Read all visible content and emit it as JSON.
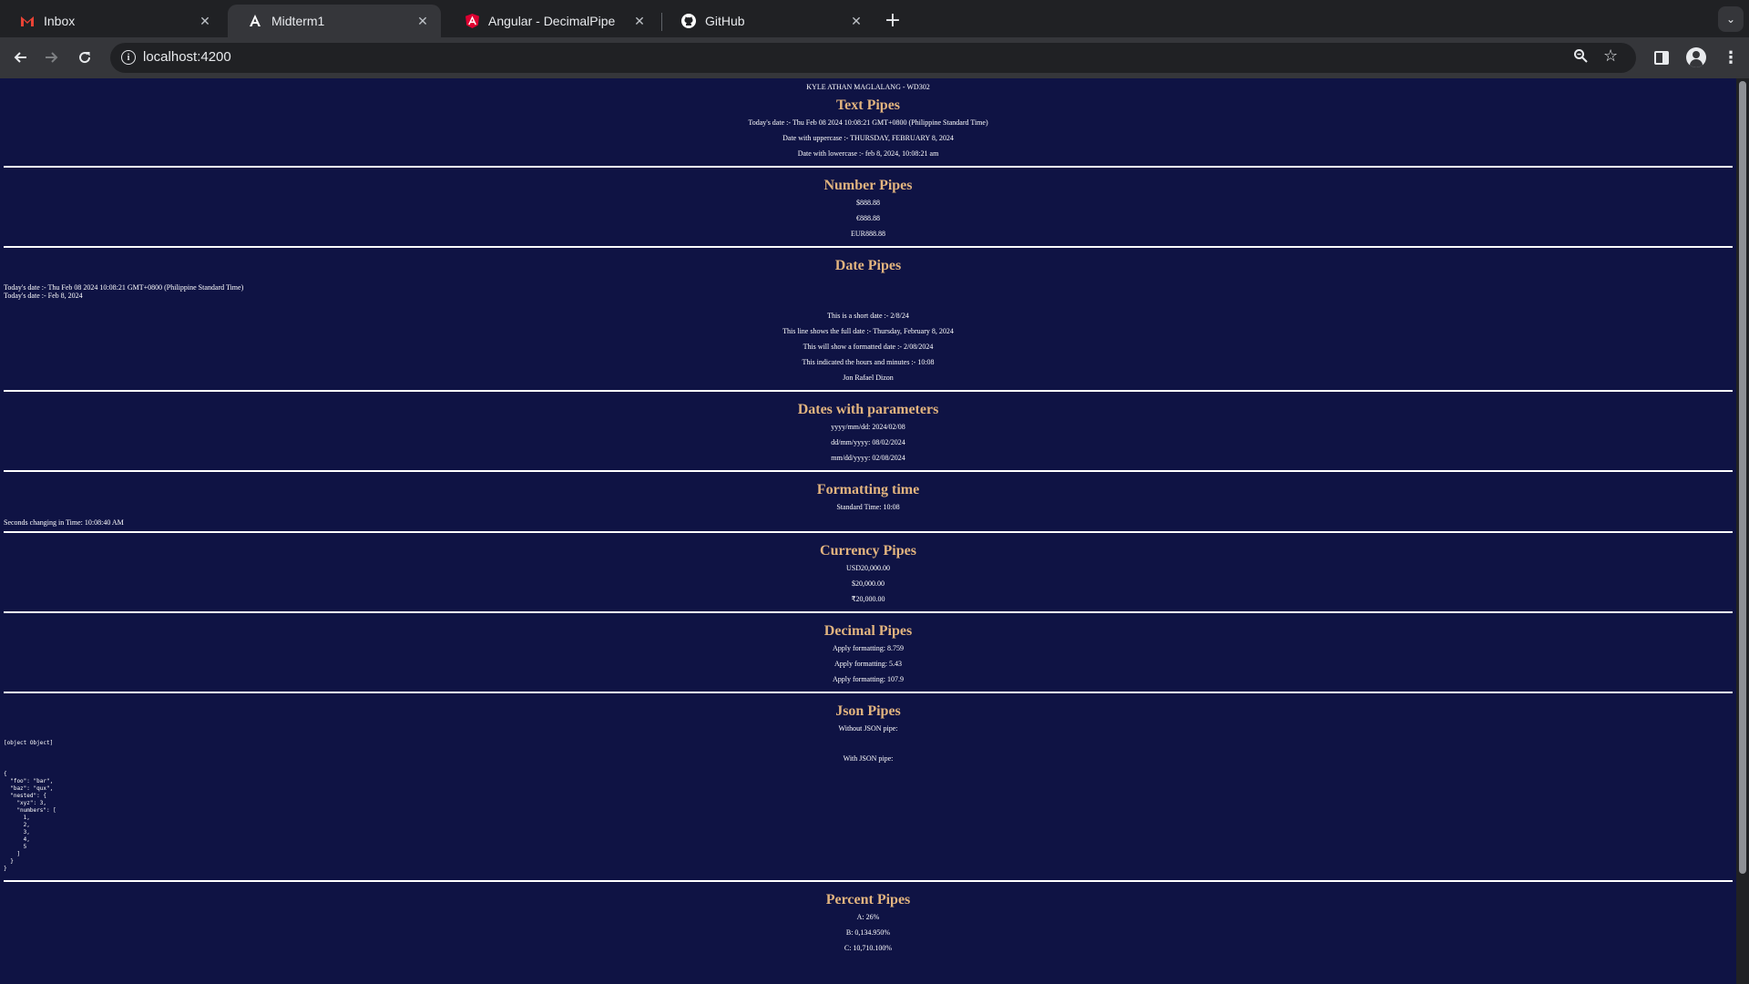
{
  "browser": {
    "tabs": [
      {
        "title": "Inbox",
        "icon": "gmail-icon"
      },
      {
        "title": "Midterm1",
        "icon": "angular-icon"
      },
      {
        "title": "Angular - DecimalPipe",
        "icon": "angular-icon"
      },
      {
        "title": "GitHub",
        "icon": "github-icon"
      }
    ],
    "active_tab": 1,
    "url": "localhost:4200"
  },
  "page": {
    "header": "KYLE ATHAN MAGLALANG - WD302",
    "text_pipes": {
      "heading": "Text Pipes",
      "lines": [
        "Today's date :- Thu Feb 08 2024 10:08:21 GMT+0800 (Philippine Standard Time)",
        "Date with uppercase :- THURSDAY, FEBRUARY 8, 2024",
        "Date with lowercase :- feb 8, 2024, 10:08:21 am"
      ]
    },
    "number_pipes": {
      "heading": "Number Pipes",
      "lines": [
        "$888.88",
        "€888.88",
        "EUR888.88"
      ]
    },
    "date_pipes": {
      "heading": "Date Pipes",
      "left_lines": [
        "Today's date :- Thu Feb 08 2024 10:08:21 GMT+0800 (Philippine Standard Time)",
        "Today's date :- Feb 8, 2024"
      ],
      "lines": [
        "This is a short date :- 2/8/24",
        "This line shows the full date :- Thursday, February 8, 2024",
        "This will show a formatted date :- 2/08/2024",
        "This indicated the hours and minutes :- 10:08",
        "Jon Rafael Dizon"
      ]
    },
    "dates_with_parameters": {
      "heading": "Dates with parameters",
      "lines": [
        "yyyy/mm/dd: 2024/02/08",
        "dd/mm/yyyy: 08/02/2024",
        "mm/dd/yyyy: 02/08/2024"
      ]
    },
    "formatting_time": {
      "heading": "Formatting time",
      "line": "Standard Time: 10:08",
      "left_line": "Seconds changing in Time: 10:08:40 AM"
    },
    "currency_pipes": {
      "heading": "Currency Pipes",
      "lines": [
        "USD20,000.00",
        "$20,000.00",
        "₹20,000.00"
      ]
    },
    "decimal_pipes": {
      "heading": "Decimal Pipes",
      "lines": [
        "Apply formatting: 8.759",
        "Apply formatting: 5.43",
        "Apply formatting: 107.9"
      ]
    },
    "json_pipes": {
      "heading": "Json Pipes",
      "without_label": "Without JSON pipe:",
      "object_text": "[object Object]",
      "with_label": "With JSON pipe:",
      "json_text": "{\n  \"foo\": \"bar\",\n  \"baz\": \"qux\",\n  \"nested\": {\n    \"xyz\": 3,\n    \"numbers\": [\n      1,\n      2,\n      3,\n      4,\n      5\n    ]\n  }\n}"
    },
    "percent_pipes": {
      "heading": "Percent Pipes",
      "lines": [
        "A: 26%",
        "B: 0,134.950%",
        "C: 10,710.100%"
      ]
    }
  }
}
